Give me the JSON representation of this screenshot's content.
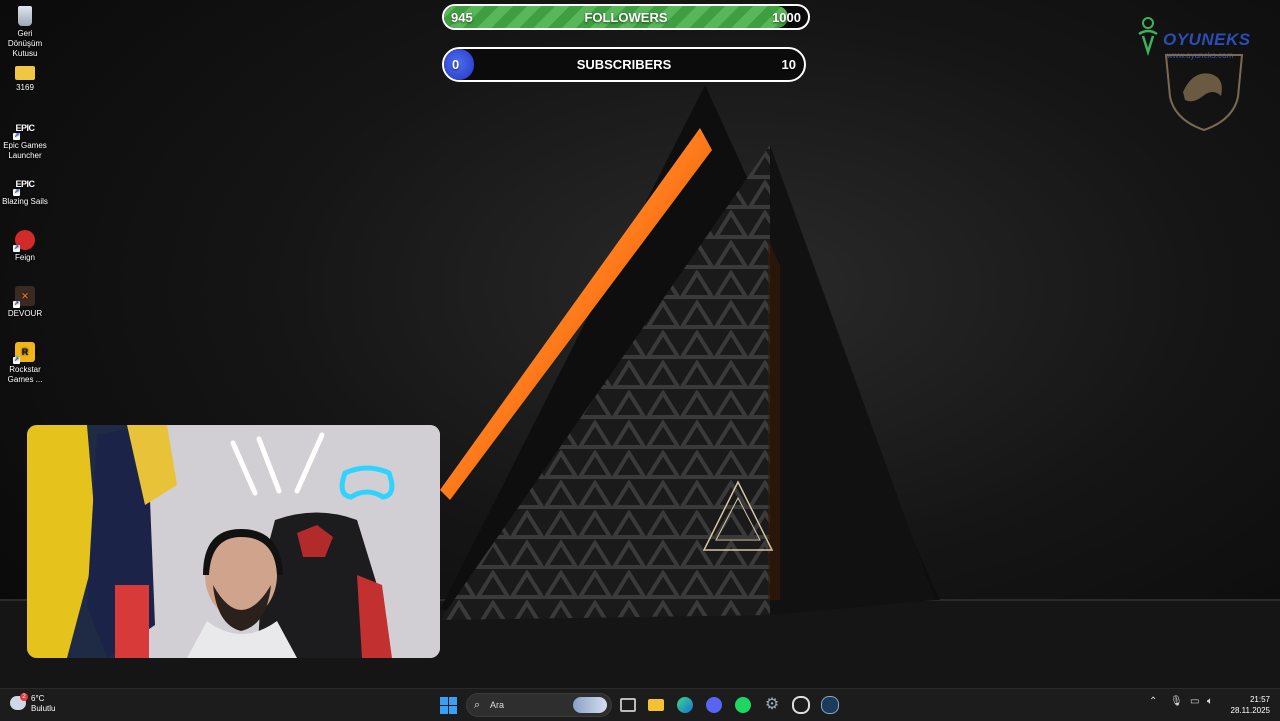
{
  "desktop": {
    "icons": [
      {
        "label_line1": "Geri",
        "label_line2": "Dönüşüm",
        "label_line3": "Kutusu",
        "icon": "recycle-bin-icon"
      },
      {
        "label_line1": "3169",
        "icon": "folder-icon"
      },
      {
        "label_line1": "Epic Games",
        "label_line2": "Launcher",
        "icon": "epic-games-icon"
      },
      {
        "label_line1": "Blazing Sails",
        "icon": "epic-games-icon"
      },
      {
        "label_line1": "Feign",
        "icon": "feign-icon"
      },
      {
        "label_line1": "DEVOUR",
        "icon": "devour-icon"
      },
      {
        "label_line1": "Rockstar",
        "label_line2": "Games ...",
        "icon": "rockstar-icon"
      }
    ],
    "epic_glyph": "EPIC"
  },
  "overlay": {
    "followers": {
      "current": "945",
      "label": "FOLLOWERS",
      "goal": "1000",
      "progress": 0.945,
      "color": "#4caf50"
    },
    "subscribers": {
      "current": "0",
      "label": "SUBSCRIBERS",
      "goal": "10",
      "progress": 0.0,
      "color": "#2f45d8"
    }
  },
  "logo": {
    "text": "OYUNEKS",
    "url": "www.oyuneks.com"
  },
  "taskbar": {
    "weather": {
      "temp": "6°C",
      "condition": "Bulutlu",
      "badge": "2"
    },
    "search_placeholder": "Ara",
    "pinned": [
      "windows-start-icon",
      "task-view-icon",
      "file-explorer-icon",
      "edge-icon",
      "discord-icon",
      "spotify-icon",
      "settings-icon",
      "chrome-icon",
      "steam-icon"
    ],
    "clock": {
      "time": "21:57",
      "date": "28.11.2025"
    }
  }
}
